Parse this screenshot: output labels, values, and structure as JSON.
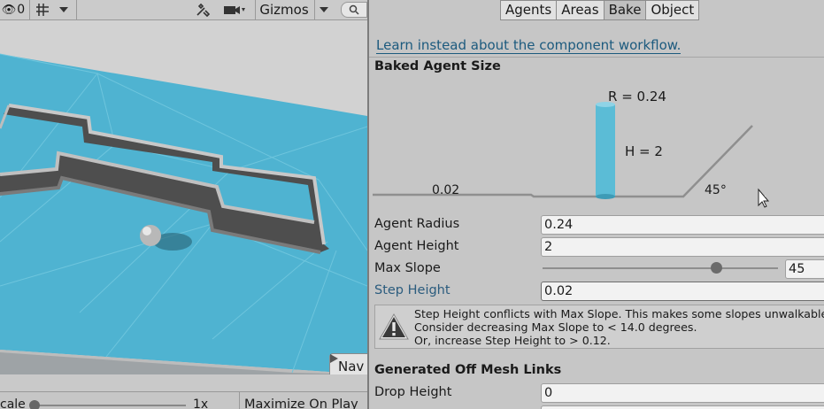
{
  "scene_toolbar": {
    "hidden_count": "0",
    "gizmos_label": "Gizmos",
    "search_icon": "search-icon",
    "visibility_icon": "eye-slash-icon",
    "grid_icon": "grid-icon",
    "tools_icon": "tools-icon",
    "camera_icon": "camera-icon"
  },
  "scene_overlay": {
    "button_label": "Nav"
  },
  "game_bar": {
    "scale_label": "cale",
    "scale_value": "1x",
    "maximize_label": "Maximize On Play"
  },
  "inspector": {
    "tabs": [
      {
        "label": "Agents",
        "active": false
      },
      {
        "label": "Areas",
        "active": false
      },
      {
        "label": "Bake",
        "active": true
      },
      {
        "label": "Object",
        "active": false
      }
    ],
    "learn_link": "Learn instead about the component workflow.",
    "baked_agent_size": {
      "title": "Baked Agent Size",
      "radius_label": "R = 0.24",
      "height_label": "H = 2",
      "step_label": "0.02",
      "slope_label": "45°"
    },
    "fields": {
      "agent_radius": {
        "label": "Agent Radius",
        "value": "0.24"
      },
      "agent_height": {
        "label": "Agent Height",
        "value": "2"
      },
      "max_slope": {
        "label": "Max Slope",
        "value": "45",
        "slider_fraction": 0.74
      },
      "step_height": {
        "label": "Step Height",
        "value": "0.02"
      }
    },
    "warning": {
      "icon": "warning-icon",
      "line1": "Step Height conflicts with Max Slope. This makes some slopes unwalkable.",
      "line2": "Consider decreasing Max Slope to < 14.0 degrees.",
      "line3": "Or, increase Step Height to > 0.12."
    },
    "off_mesh": {
      "title": "Generated Off Mesh Links",
      "drop_height": {
        "label": "Drop Height",
        "value": "0"
      }
    }
  },
  "colors": {
    "navmesh_blue": "#4fb3d1",
    "cylinder_blue": "#5bbcd6",
    "link": "#1c5a7e",
    "step_height_label": "#2b5c7e"
  }
}
